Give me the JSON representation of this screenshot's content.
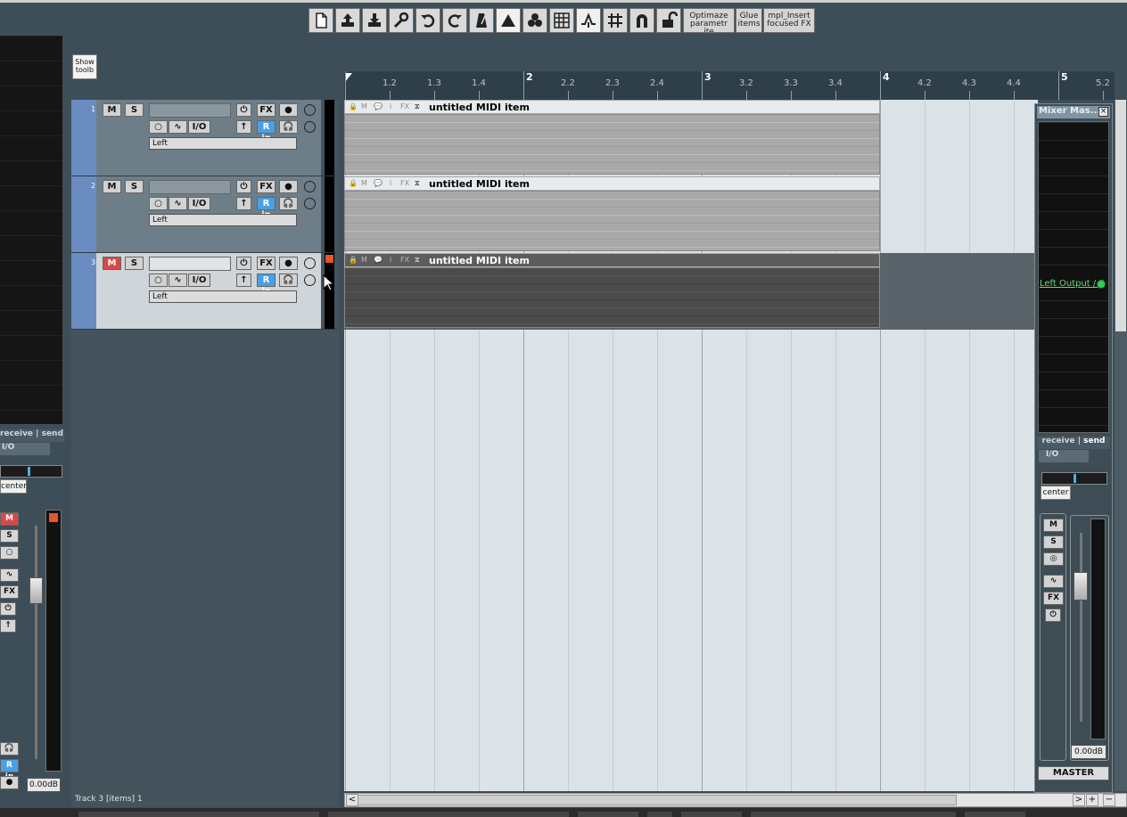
{
  "toolbar": {
    "buttons": [
      {
        "name": "new-project-icon"
      },
      {
        "name": "open-project-icon"
      },
      {
        "name": "save-project-icon"
      },
      {
        "name": "preferences-icon"
      },
      {
        "name": "undo-icon"
      },
      {
        "name": "redo-icon"
      },
      {
        "name": "metronome-icon"
      },
      {
        "name": "auto-crossfade-icon"
      },
      {
        "name": "item-grouping-icon"
      },
      {
        "name": "snap-grid-icon"
      },
      {
        "name": "ripple-edit-icon"
      },
      {
        "name": "grid-icon"
      },
      {
        "name": "snap-magnet-icon"
      },
      {
        "name": "lock-icon"
      }
    ],
    "optimize_label": "Optimaze\nparametr ite",
    "glue_label": "Glue\nitems",
    "insert_fx_label": "mpl_Insert\nfocused FX",
    "show_toolbar_label": "Show\ntoolb"
  },
  "ruler": {
    "labels": [
      "1.2",
      "1.3",
      "1.4",
      "2",
      "2.2",
      "2.3",
      "2.4",
      "3",
      "3.2",
      "3.3",
      "3.4",
      "4",
      "4.2",
      "4.3",
      "4.4",
      "5",
      "5.2"
    ]
  },
  "tracks": [
    {
      "number": "1",
      "mute": "M",
      "solo": "S",
      "fx": "FX",
      "io": "I/O",
      "input": "R in",
      "output": "Left",
      "selected": false
    },
    {
      "number": "2",
      "mute": "M",
      "solo": "S",
      "fx": "FX",
      "io": "I/O",
      "input": "R in",
      "output": "Left",
      "selected": false
    },
    {
      "number": "3",
      "mute": "M",
      "solo": "S",
      "fx": "FX",
      "io": "I/O",
      "input": "R in",
      "output": "Left",
      "selected": true
    }
  ],
  "items": [
    {
      "title": "untitled MIDI item"
    },
    {
      "title": "untitled MIDI item"
    },
    {
      "title": "untitled MIDI item"
    }
  ],
  "item_icons": {
    "lock": "🔒",
    "m": "M",
    "bubble": "💬",
    "i": "i",
    "fx": "FX"
  },
  "left_mixer": {
    "receive_send": "receive | send",
    "io": "I/O",
    "pan": "center",
    "mute": "M",
    "solo": "S",
    "fx": "FX",
    "input": "R in",
    "volume": "0.00dB"
  },
  "master": {
    "title": "Mixer Mas...",
    "close": "×",
    "output": "Left Output / F",
    "receive": "receive",
    "send": "send",
    "io": "I/O",
    "pan": "center",
    "mute": "M",
    "solo": "S",
    "fx": "FX",
    "volume": "0.00dB",
    "label": "MASTER"
  },
  "status": {
    "text": "Track 3 [items] 1"
  },
  "scroll": {
    "left": "<",
    "right": ">",
    "plus": "+",
    "minus": "−"
  },
  "colors": {
    "track_color": "#6a8cc0",
    "mute_active": "#d84848",
    "input_blue": "#4aa0e6",
    "clip": "#e8542b"
  }
}
